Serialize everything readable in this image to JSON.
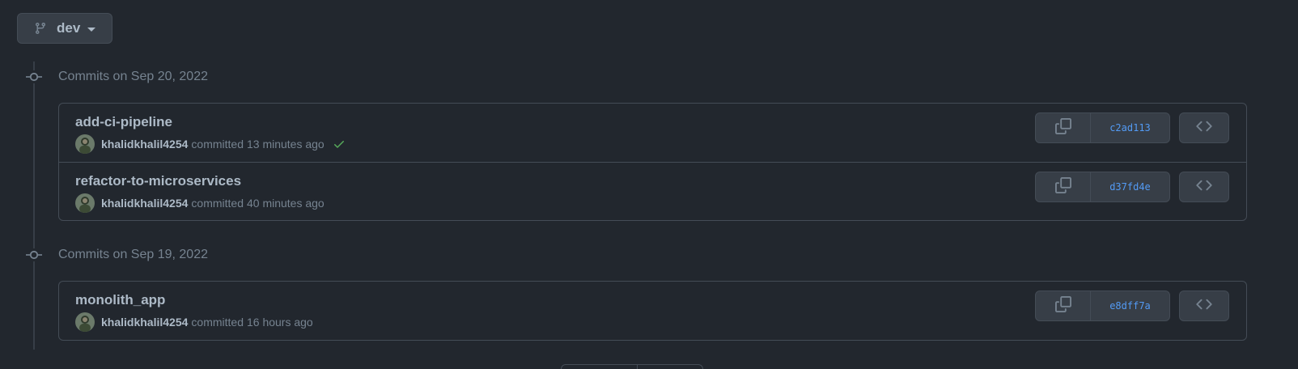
{
  "branch": {
    "name": "dev",
    "icon": "git-branch-icon"
  },
  "groups": [
    {
      "title": "Commits on Sep 20, 2022",
      "commits": [
        {
          "title": "add-ci-pipeline",
          "author": "khalidkhalil4254",
          "committed_word": "committed",
          "time": "13 minutes ago",
          "status": "success",
          "sha": "c2ad113"
        },
        {
          "title": "refactor-to-microservices",
          "author": "khalidkhalil4254",
          "committed_word": "committed",
          "time": "40 minutes ago",
          "status": "",
          "sha": "d37fd4e"
        }
      ]
    },
    {
      "title": "Commits on Sep 19, 2022",
      "commits": [
        {
          "title": "monolith_app",
          "author": "khalidkhalil4254",
          "committed_word": "committed",
          "time": "16 hours ago",
          "status": "",
          "sha": "e8dff7a"
        }
      ]
    }
  ],
  "icons": {
    "copy": "copy-icon",
    "browse": "code-icon",
    "node": "git-commit-icon",
    "check": "check-icon"
  },
  "colors": {
    "background": "#22272e",
    "border": "#444c56",
    "sha_link": "#539bf5",
    "success": "#57ab5a"
  }
}
